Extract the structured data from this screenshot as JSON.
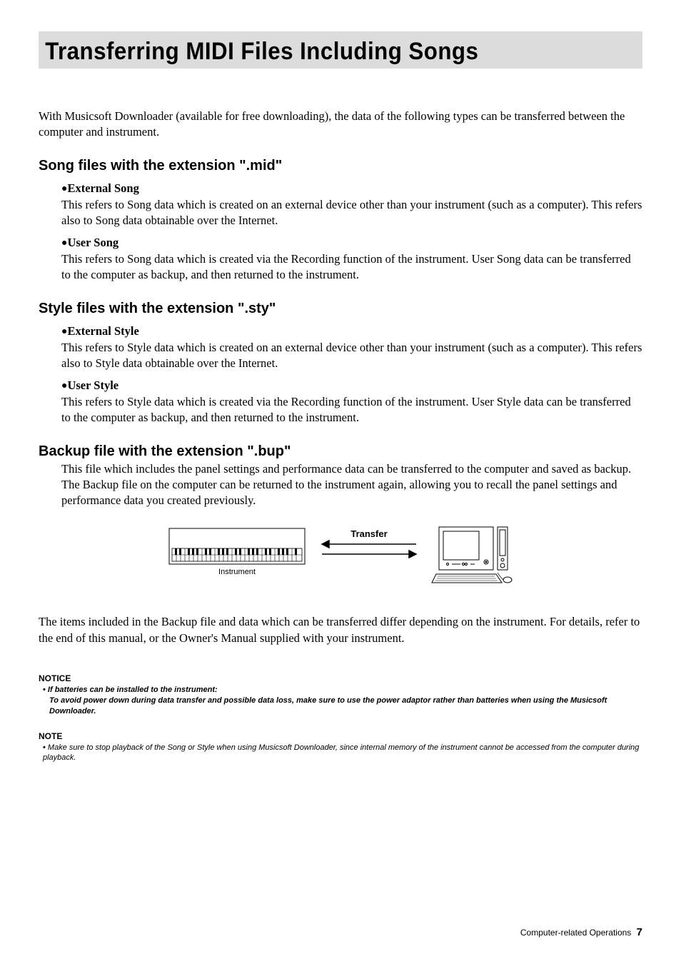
{
  "header": {
    "title": "Transferring MIDI Files Including Songs"
  },
  "intro": "With Musicsoft Downloader (available for free downloading), the data of the following types can be transferred between the computer and instrument.",
  "sections": [
    {
      "heading": "Song files with the extension \".mid\"",
      "items": [
        {
          "title": "External Song",
          "body": "This refers to Song data which is created on an external device other than your instrument (such as a computer). This refers also to Song data obtainable over the Internet."
        },
        {
          "title": "User Song",
          "body": "This refers to Song data which is created via the Recording function of the instrument. User Song data can be transferred to the computer as backup, and then returned to the instrument."
        }
      ]
    },
    {
      "heading": "Style files with the extension \".sty\"",
      "items": [
        {
          "title": "External Style",
          "body": "This refers to Style data which is created on an external device other than your instrument (such as a computer). This refers also to Style data obtainable over the Internet."
        },
        {
          "title": "User Style",
          "body": "This refers to Style data which is created via the Recording function of the instrument. User Style data can be transferred to the computer as backup, and then returned to the instrument."
        }
      ]
    },
    {
      "heading": "Backup file with the extension \".bup\"",
      "body": "This file which includes the panel settings and performance data can be transferred to the computer and saved as backup. The Backup file on the computer can be returned to the instrument again, allowing you to recall the panel settings and performance data you created previously."
    }
  ],
  "diagram": {
    "transfer_label": "Transfer",
    "instrument_label": "Instrument"
  },
  "post_diagram": "The items included in the Backup file and data which can be transferred differ depending on the instrument. For details, refer to the end of this manual, or the Owner's Manual supplied with your instrument.",
  "notice": {
    "label": "NOTICE",
    "line1": "If batteries can be installed to the instrument:",
    "line2": "To avoid power down during data transfer and possible data loss, make sure to use the power adaptor rather than batteries when using the Musicsoft Downloader."
  },
  "note": {
    "label": "NOTE",
    "line1": "Make sure to stop playback of the Song or Style when using Musicsoft Downloader, since internal memory of the instrument cannot be accessed from the computer during playback."
  },
  "footer": {
    "text": "Computer-related Operations",
    "page": "7"
  }
}
